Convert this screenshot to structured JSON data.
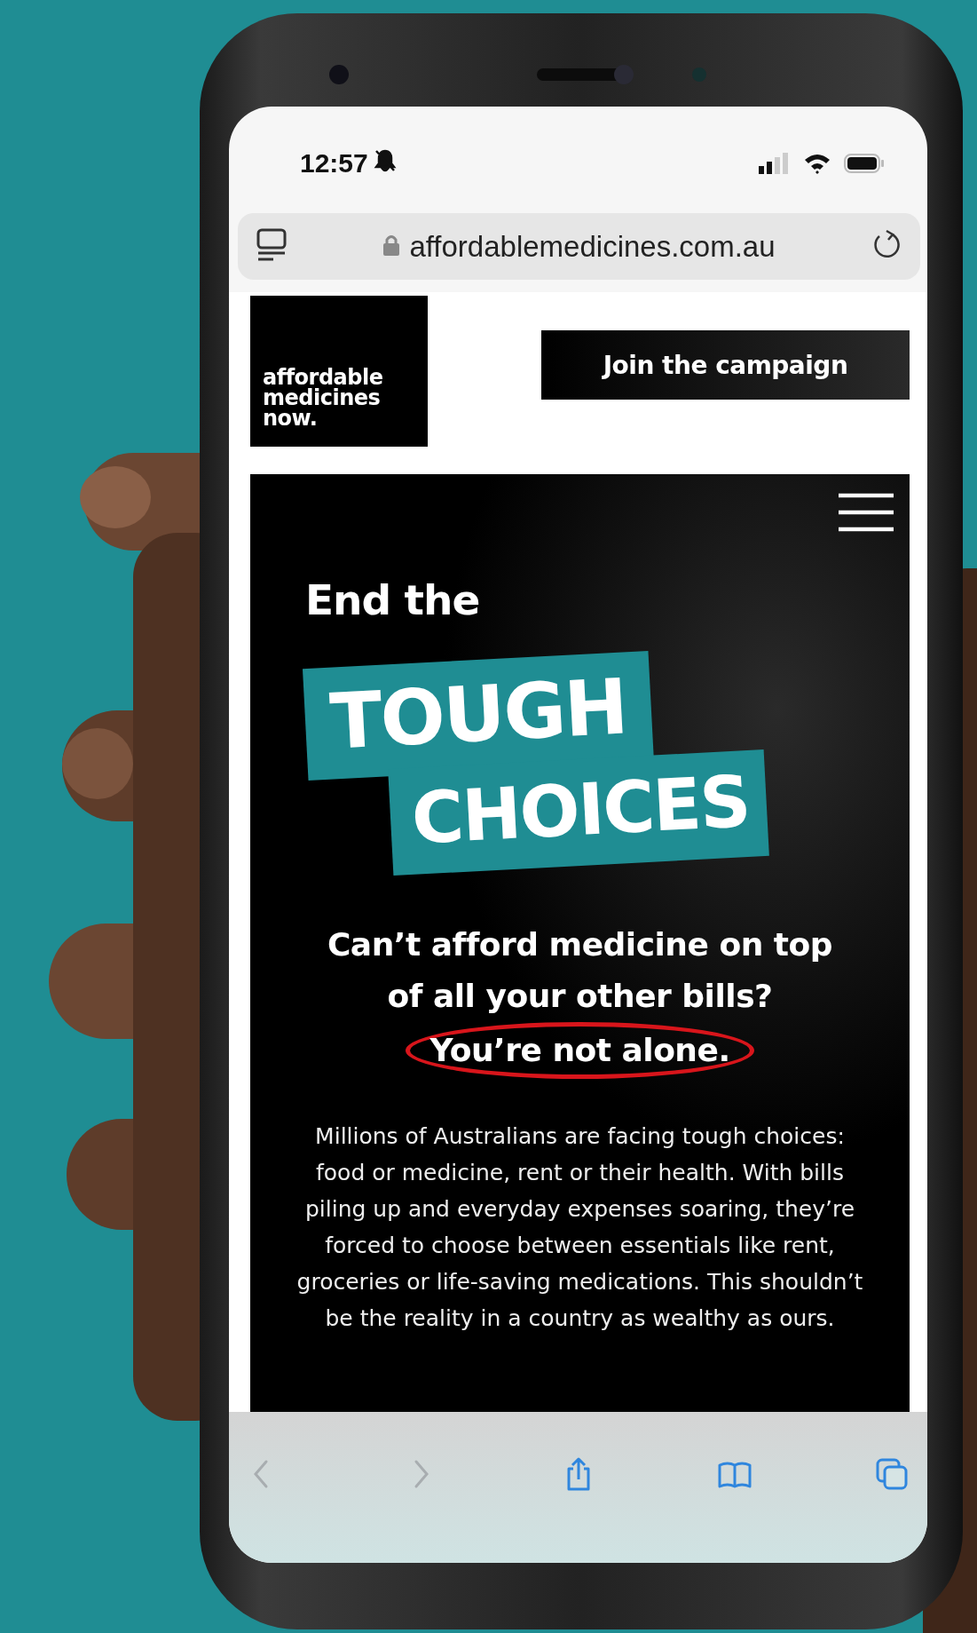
{
  "status_bar": {
    "time": "12:57"
  },
  "address_bar": {
    "url": "affordablemedicines.com.au"
  },
  "site_header": {
    "logo_lines": [
      "affordable",
      "medicines",
      "now."
    ],
    "button": "Join the campaign"
  },
  "hero": {
    "lead": "End the",
    "headline": [
      "TOUGH",
      "CHOICES"
    ],
    "question": "Can’t afford medicine on top of all your other bills?",
    "emphasis": "You’re not alone.",
    "body": "Millions of Australians are facing tough choices: food or medicine, rent or their health. With bills piling up and everyday expenses soaring, they’re forced to choose between essentials like rent, groceries or life-saving medications. This shouldn’t be the reality in a country as wealthy as ours."
  },
  "toolbar": [
    {
      "kind": "back",
      "disabled": true
    },
    {
      "kind": "forward",
      "disabled": true
    },
    {
      "kind": "share",
      "disabled": false
    },
    {
      "kind": "bookmarks",
      "disabled": false
    },
    {
      "kind": "tabs",
      "disabled": false
    }
  ]
}
